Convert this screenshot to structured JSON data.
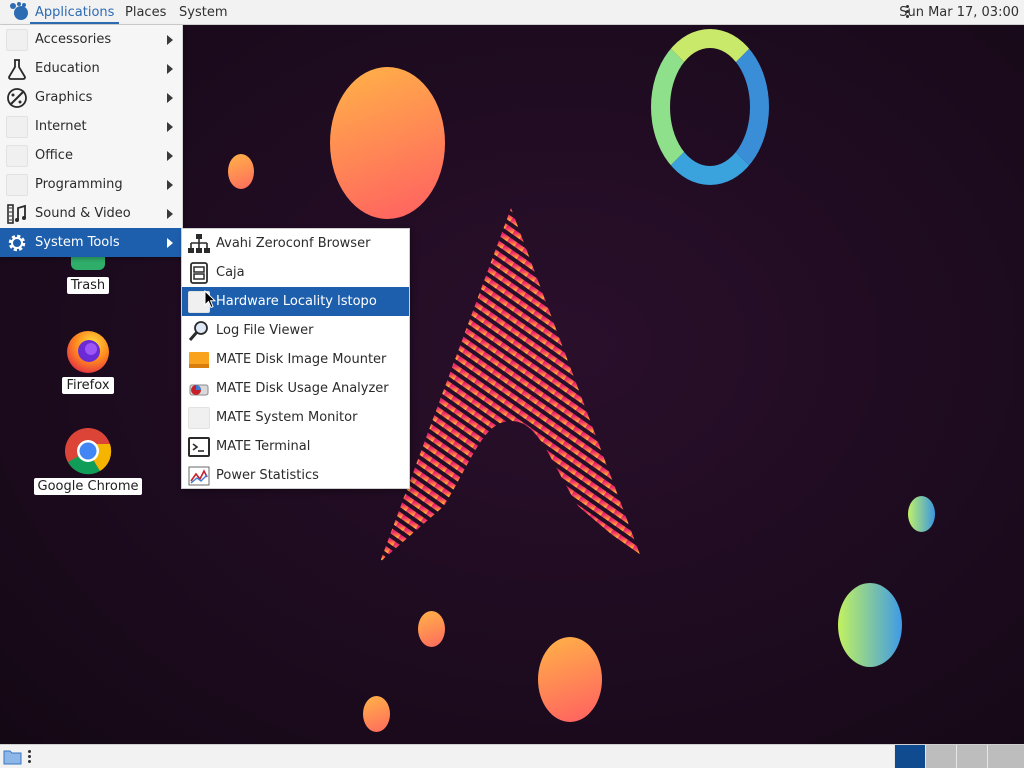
{
  "top_panel": {
    "applications_label": "Applications",
    "places_label": "Places",
    "system_label": "System",
    "clock": "Sun Mar 17, 03:00"
  },
  "applications_menu": {
    "items": [
      {
        "label": "Accessories"
      },
      {
        "label": "Education"
      },
      {
        "label": "Graphics"
      },
      {
        "label": "Internet"
      },
      {
        "label": "Office"
      },
      {
        "label": "Programming"
      },
      {
        "label": "Sound & Video"
      },
      {
        "label": "System Tools"
      }
    ]
  },
  "system_tools_menu": {
    "items": [
      {
        "label": "Avahi Zeroconf Browser"
      },
      {
        "label": "Caja"
      },
      {
        "label": "Hardware Locality lstopo"
      },
      {
        "label": "Log File Viewer"
      },
      {
        "label": "MATE Disk Image Mounter"
      },
      {
        "label": "MATE Disk Usage Analyzer"
      },
      {
        "label": "MATE System Monitor"
      },
      {
        "label": "MATE Terminal"
      },
      {
        "label": "Power Statistics"
      }
    ]
  },
  "desktop": {
    "icons": [
      {
        "label": "Trash"
      },
      {
        "label": "Firefox"
      },
      {
        "label": "Google Chrome"
      }
    ]
  },
  "colors": {
    "accent": "#1e5fad",
    "panel": "#f2f2f2",
    "workspace_active": "#104b8f"
  }
}
